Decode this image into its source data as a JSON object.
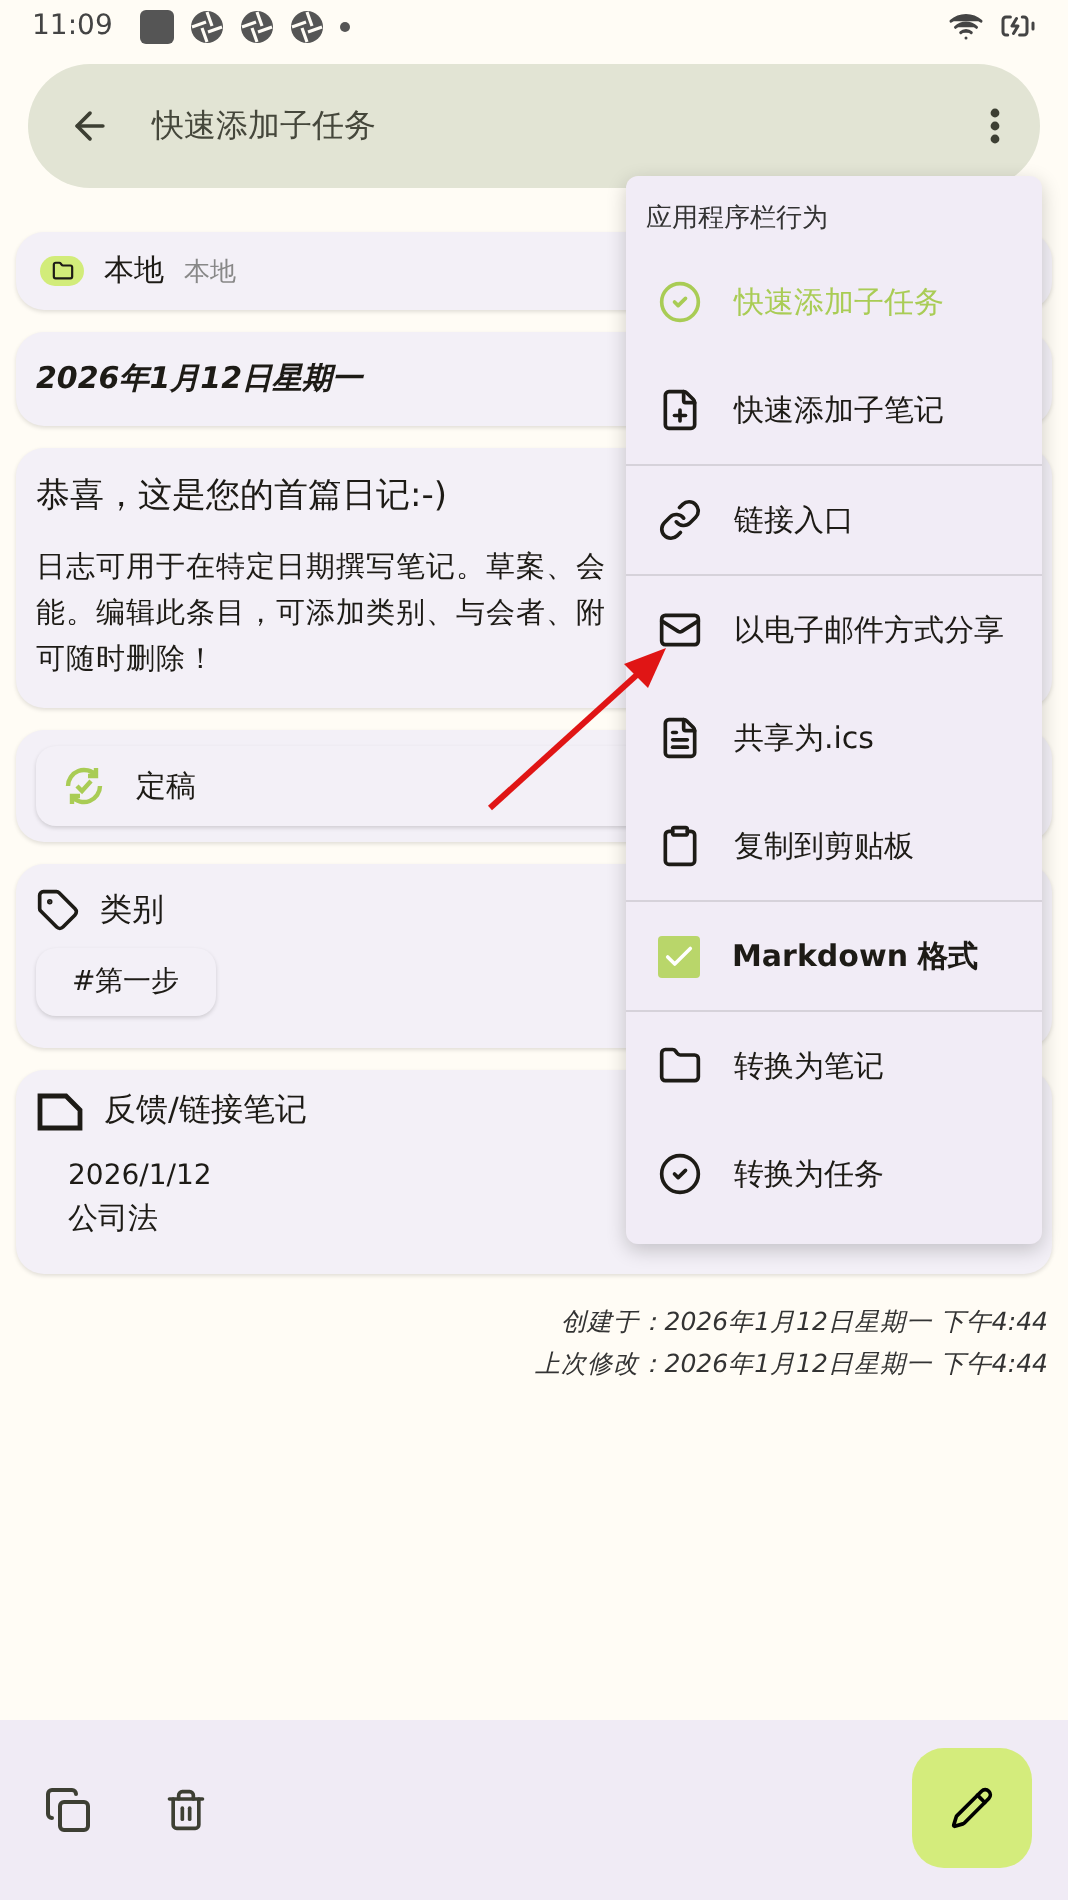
{
  "status_bar": {
    "time": "11:09"
  },
  "top_bar": {
    "title": "快速添加子任务"
  },
  "collection": {
    "name": "本地",
    "account": "本地"
  },
  "date_heading": "2026年1月12日星期一",
  "note": {
    "title": "恭喜，这是您的首篇日记:-)",
    "lines": [
      "日志可用于在特定日期撰写笔记。草案、会",
      "能。编辑此条目，可添加类别、与会者、附",
      "可随时删除！"
    ]
  },
  "status": {
    "label": "定稿"
  },
  "categories": {
    "heading": "类别",
    "tags": [
      "#第一步"
    ]
  },
  "linked": {
    "heading": "反馈/链接笔记",
    "items": [
      {
        "date": "2026/1/12",
        "title": "公司法"
      }
    ]
  },
  "meta": [
    "创建于：2026年1月12日星期一 下午4:44",
    "上次修改：2026年1月12日星期一 下午4:44"
  ],
  "menu": {
    "header": "应用程序栏行为",
    "groups": [
      [
        {
          "kind": "action",
          "label": "快速添加子任务",
          "highlighted": true
        },
        {
          "kind": "action",
          "label": "快速添加子笔记",
          "highlighted": false
        }
      ],
      [
        {
          "kind": "action",
          "label": "链接入口",
          "highlighted": false
        }
      ],
      [
        {
          "kind": "action",
          "label": "以电子邮件方式分享",
          "highlighted": false
        },
        {
          "kind": "action",
          "label": "共享为.ics",
          "highlighted": false
        },
        {
          "kind": "action",
          "label": "复制到剪贴板",
          "highlighted": false
        }
      ],
      [
        {
          "kind": "checkbox",
          "label": "Markdown 格式",
          "checked": true
        }
      ],
      [
        {
          "kind": "action",
          "label": "转换为笔记",
          "highlighted": false
        },
        {
          "kind": "action",
          "label": "转换为任务",
          "highlighted": false
        }
      ]
    ]
  }
}
